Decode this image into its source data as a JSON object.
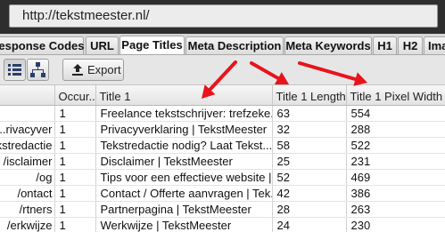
{
  "address_bar": {
    "url": "http://tekstmeester.nl/"
  },
  "tabs": [
    {
      "label": "Response Codes",
      "active": false
    },
    {
      "label": "URL",
      "active": false
    },
    {
      "label": "Page Titles",
      "active": true
    },
    {
      "label": "Meta Description",
      "active": false
    },
    {
      "label": "Meta Keywords",
      "active": false
    },
    {
      "label": "H1",
      "active": false
    },
    {
      "label": "H2",
      "active": false
    },
    {
      "label": "Ima",
      "active": false
    }
  ],
  "toolbar": {
    "list_view_icon": "list-view-icon",
    "tree_view_icon": "tree-view-icon",
    "export_label": "Export",
    "export_icon": "upload-icon"
  },
  "table": {
    "columns": [
      "",
      "Occur...",
      "Title 1",
      "Title 1 Length",
      "Title 1 Pixel Width"
    ],
    "rows": [
      {
        "address": "",
        "occurrences": "1",
        "title": "Freelance tekstschrijver: trefzeke...",
        "length": "63",
        "pixel_width": "554"
      },
      {
        "address": "rivacyver...",
        "occurrences": "1",
        "title": "Privacyverklaring | TekstMeester",
        "length": "32",
        "pixel_width": "288"
      },
      {
        "address": "kstredactie/",
        "occurrences": "1",
        "title": "Tekstredactie nodig? Laat Tekst...",
        "length": "58",
        "pixel_width": "522"
      },
      {
        "address": "isclaimer/",
        "occurrences": "1",
        "title": "Disclaimer | TekstMeester",
        "length": "25",
        "pixel_width": "231"
      },
      {
        "address": "og/",
        "occurrences": "1",
        "title": "Tips voor een effectieve website |...",
        "length": "52",
        "pixel_width": "469"
      },
      {
        "address": "ontact/",
        "occurrences": "1",
        "title": "Contact / Offerte aanvragen | Tek...",
        "length": "42",
        "pixel_width": "386"
      },
      {
        "address": "rtners/",
        "occurrences": "1",
        "title": "Partnerpagina | TekstMeester",
        "length": "28",
        "pixel_width": "263"
      },
      {
        "address": "erkwijze/",
        "occurrences": "1",
        "title": "Werkwijze | TekstMeester",
        "length": "24",
        "pixel_width": "230"
      }
    ]
  },
  "annotation": {
    "arrow_color": "#e8141c"
  }
}
